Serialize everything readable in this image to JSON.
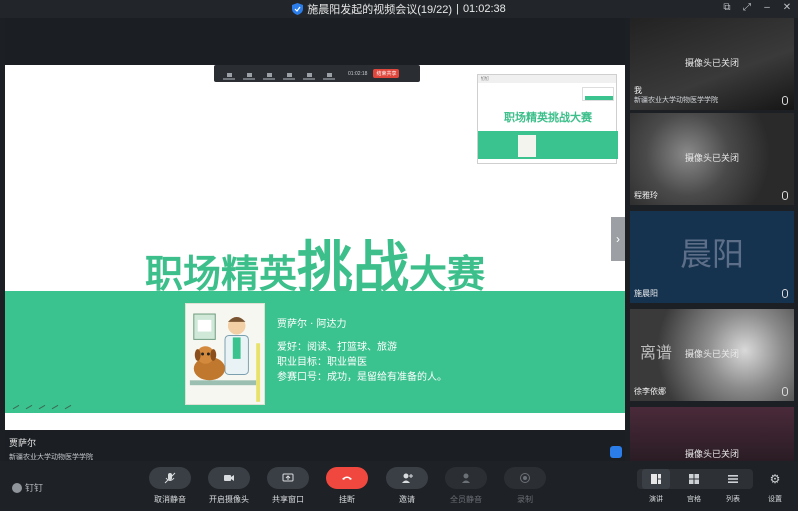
{
  "window": {
    "title": "施晨阳发起的视频会议(19/22)",
    "elapsed": "01:02:38"
  },
  "slide": {
    "title_part1": "职场精英",
    "title_part2": "挑战",
    "title_part3": "大赛",
    "profile": {
      "name": "贾萨尔 · 阿达力",
      "hobby": "爱好：阅读、打篮球、旅游",
      "goal": "职业目标：职业兽医",
      "slogan": "参赛口号：成功，是留给有准备的人。"
    },
    "minibar": {
      "time": "01:02:18",
      "stop_label": "结束共享"
    },
    "thumb": {
      "app_label": "钉钉",
      "title": "职场精英挑战大赛"
    },
    "accent_color": "#3ac28f"
  },
  "speaker": {
    "name": "贾萨尔",
    "school": "新疆农业大学动物医学学院"
  },
  "participants": [
    {
      "name": "我",
      "school": "新疆农业大学动物医学学院",
      "status": "摄像头已关闭"
    },
    {
      "name": "程雅玲",
      "status": "摄像头已关闭"
    },
    {
      "name": "施晨阳",
      "avatar_text": "晨阳"
    },
    {
      "name": "徐李依娜",
      "status": "摄像头已关闭",
      "overlay_text": "离谱"
    },
    {
      "name": "",
      "status": "摄像头已关闭"
    }
  ],
  "toolbar": {
    "logo": "钉钉",
    "mute": "取消静音",
    "camera": "开启摄像头",
    "share": "共享窗口",
    "hangup": "挂断",
    "invite": "邀请",
    "mute_all": "全员静音",
    "record": "录制",
    "view_speaker": "演讲",
    "view_gallery": "宫格",
    "view_list": "列表",
    "settings": "设置"
  }
}
